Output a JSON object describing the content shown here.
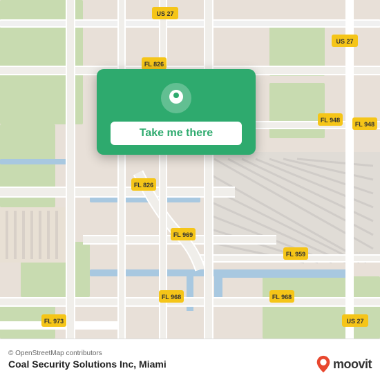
{
  "map": {
    "background_color": "#e8e0d8",
    "road_color": "#ffffff",
    "highway_color": "#f5c842",
    "water_color": "#b8d4e8",
    "green_color": "#c8dbb0"
  },
  "card": {
    "background_color": "#2eaa6e",
    "button_label": "Take me there",
    "button_bg": "#ffffff",
    "button_text_color": "#2eaa6e"
  },
  "attribution": {
    "text": "© OpenStreetMap contributors"
  },
  "location": {
    "name": "Coal Security Solutions Inc, Miami"
  },
  "moovit": {
    "text": "moovit",
    "pin_color": "#e8472e"
  },
  "routes": {
    "us27_label": "US 27",
    "fl826_label": "FL 826",
    "fl948_label": "FL 948",
    "fl969_label": "FL 969",
    "fl959_label": "FL 959",
    "fl968_label": "FL 968",
    "fl973_label": "FL 973"
  }
}
